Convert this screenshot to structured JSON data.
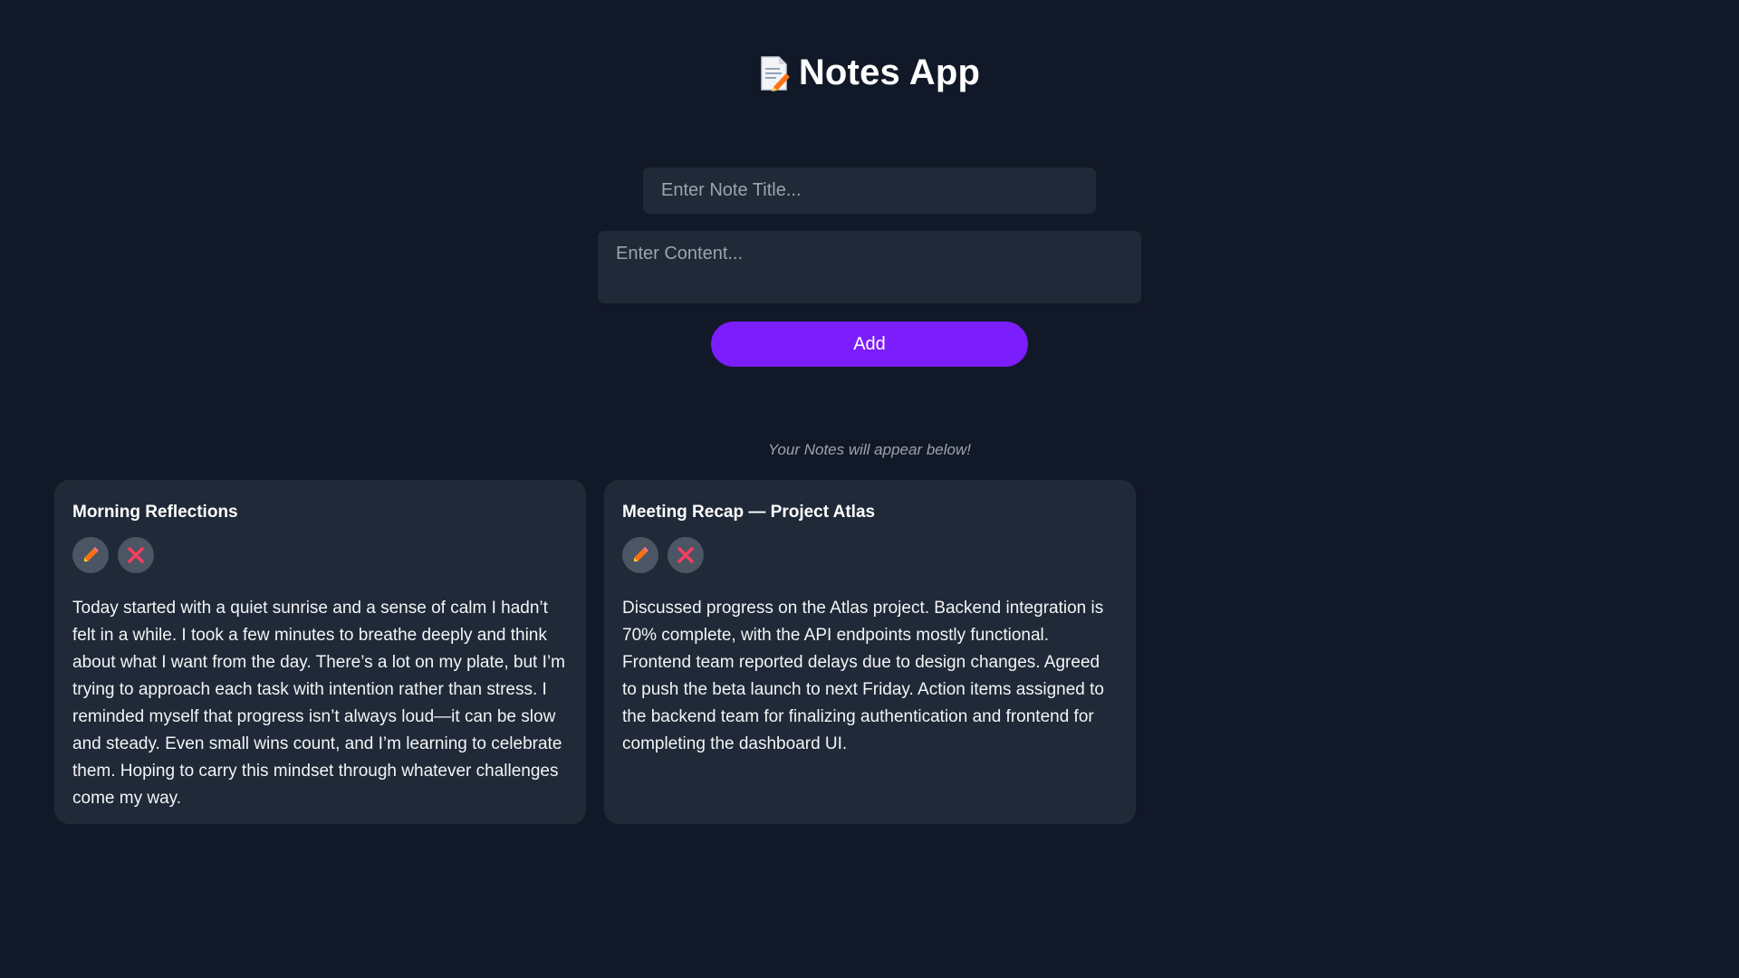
{
  "header": {
    "title": "Notes App",
    "icon": "memo-icon"
  },
  "form": {
    "title_placeholder": "Enter Note Title...",
    "content_placeholder": "Enter Content...",
    "add_label": "Add"
  },
  "hint": "Your Notes will appear below!",
  "notes": [
    {
      "title": "Morning Reflections",
      "content": "Today started with a quiet sunrise and a sense of calm I hadn’t felt in a while. I took a few minutes to breathe deeply and think about what I want from the day. There’s a lot on my plate, but I’m trying to approach each task with intention rather than stress. I reminded myself that progress isn’t always loud—it can be slow and steady. Even small wins count, and I’m learning to celebrate them. Hoping to carry this mindset through whatever challenges come my way."
    },
    {
      "title": "Meeting Recap — Project Atlas",
      "content": "Discussed progress on the Atlas project. Backend integration is 70% complete, with the API endpoints mostly functional. Frontend team reported delays due to design changes. Agreed to push the beta launch to next Friday. Action items assigned to the backend team for finalizing authentication and frontend for completing the dashboard UI."
    }
  ],
  "colors": {
    "background": "#111827",
    "card": "#1f2937",
    "accent": "#7c1dfb",
    "delete": "#f43f5e",
    "edit": "#f97316"
  }
}
